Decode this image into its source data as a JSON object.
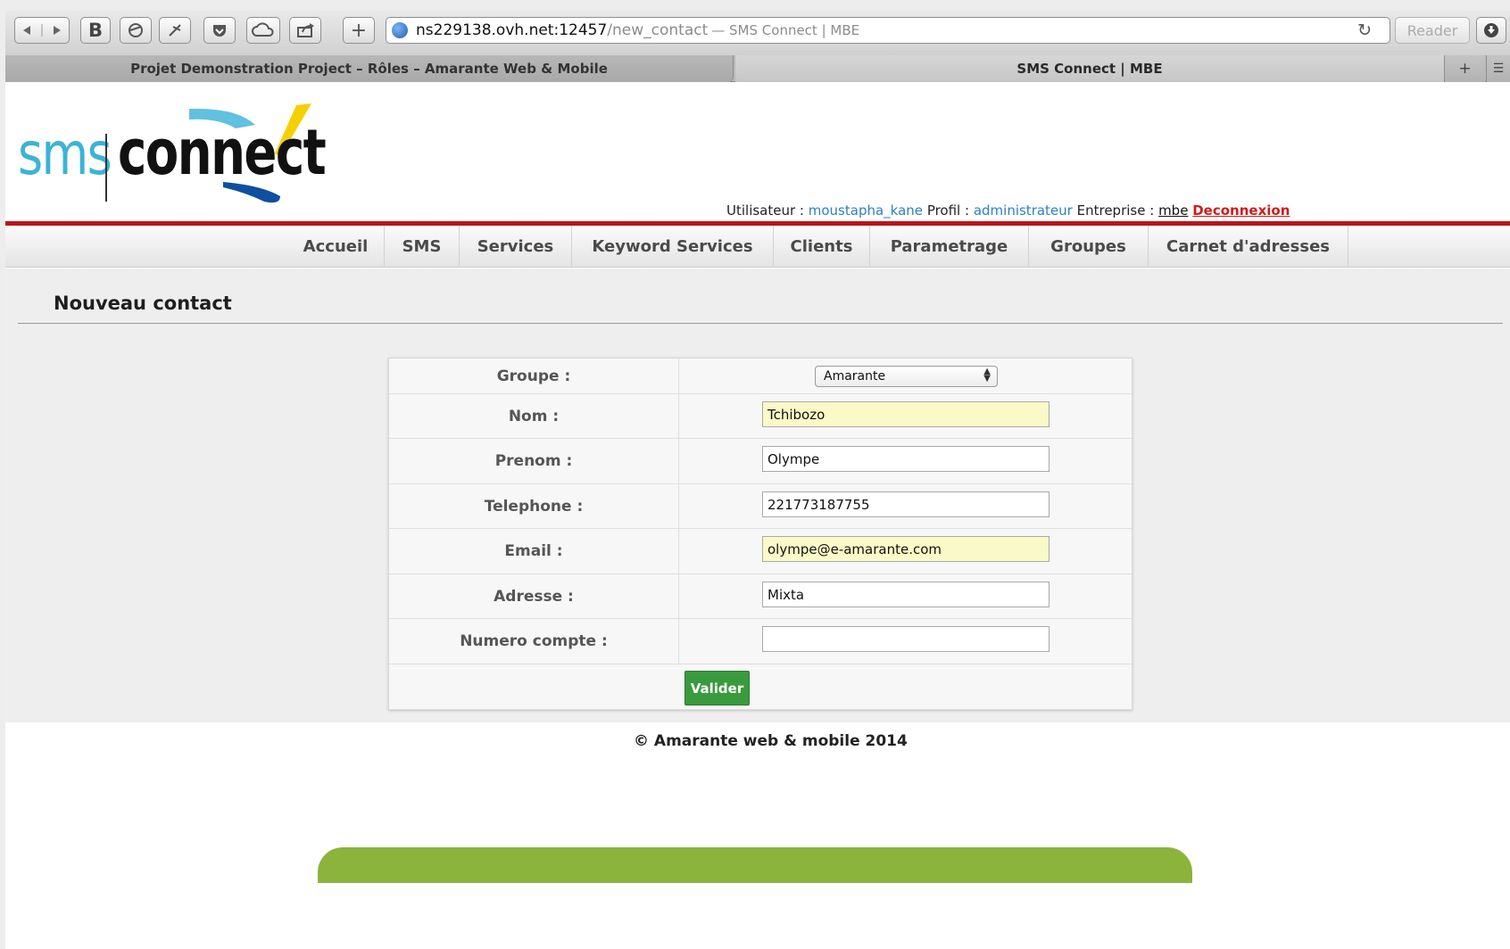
{
  "browser": {
    "url_host": "ns229138.ovh.net:12457",
    "url_path": "/new_contact",
    "url_title": "— SMS Connect | MBE",
    "reader_label": "Reader",
    "tabs": [
      {
        "label": "Projet Demonstration Project – Rôles – Amarante Web & Mobile"
      },
      {
        "label": "SMS Connect | MBE"
      }
    ],
    "new_tab_symbol": "+",
    "toolbar_buttons": [
      "back-icon",
      "forward-icon",
      "bookmark-b-icon",
      "history-icon",
      "tools-icon",
      "pocket-icon",
      "cloud-icon",
      "share-icon",
      "add-icon"
    ]
  },
  "logo": {
    "sms": "sms",
    "connect": "connect"
  },
  "userbar": {
    "user_label": "Utilisateur :",
    "user_value": "moustapha_kane",
    "profile_label": "Profil :",
    "profile_value": "administrateur",
    "company_label": "Entreprise :",
    "company_value": "mbe",
    "logout_label": "Deconnexion"
  },
  "nav": {
    "items": [
      {
        "label": "Accueil"
      },
      {
        "label": "SMS"
      },
      {
        "label": "Services"
      },
      {
        "label": "Keyword Services"
      },
      {
        "label": "Clients"
      },
      {
        "label": "Parametrage"
      },
      {
        "label": "Groupes"
      },
      {
        "label": "Carnet d'adresses"
      }
    ]
  },
  "page": {
    "title": "Nouveau contact"
  },
  "form": {
    "groupe": {
      "label": "Groupe :",
      "value": "Amarante"
    },
    "nom": {
      "label": "Nom :",
      "value": "Tchibozo"
    },
    "prenom": {
      "label": "Prenom :",
      "value": "Olympe"
    },
    "telephone": {
      "label": "Telephone :",
      "value": "221773187755"
    },
    "email": {
      "label": "Email :",
      "value": "olympe@e-amarante.com"
    },
    "adresse": {
      "label": "Adresse :",
      "value": "Mixta"
    },
    "numero_compte": {
      "label": "Numero compte :",
      "value": ""
    },
    "submit_label": "Valider"
  },
  "footer": {
    "text": "© Amarante web & mobile 2014"
  },
  "colors": {
    "accent_red": "#b8151b",
    "logo_blue": "#3bb3d6",
    "logo_yellow": "#f5d000",
    "button_green": "#3a9a3e",
    "banner_green": "#8ab43c"
  }
}
